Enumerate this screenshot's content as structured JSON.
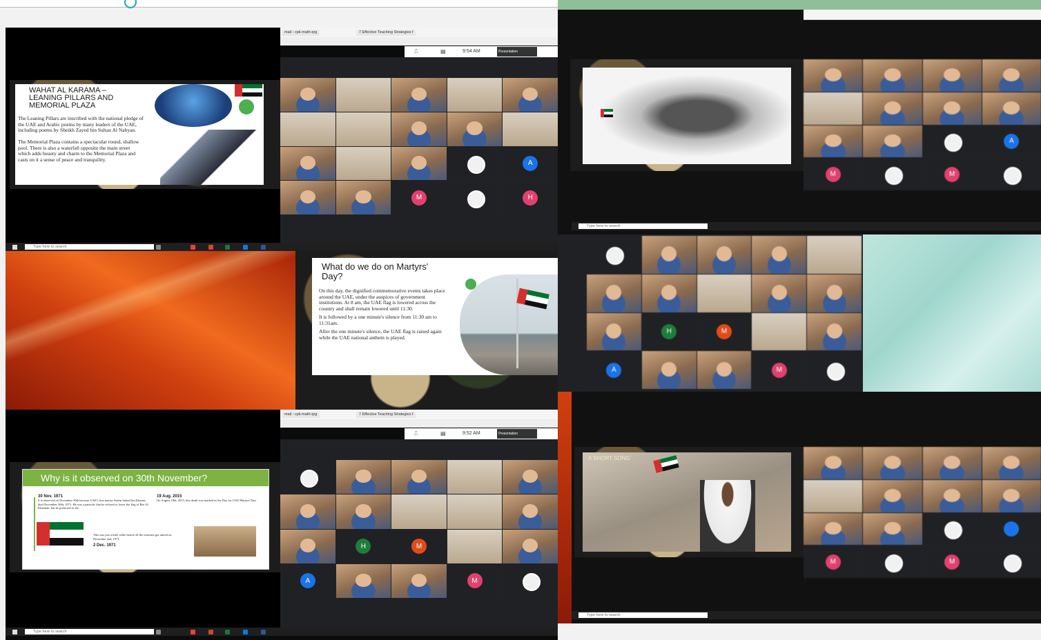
{
  "q1": {
    "browser_tab_1": "mail - cpk-math-qrg",
    "browser_tab_2": "7 Effective Teaching Strategies f",
    "clock": "9:54 AM",
    "presentation_label": "Presentation",
    "slide_title": "WAHAT AL KARAMA – LEANING PILLARS AND MEMORIAL PLAZA",
    "slide_para_1": "The Leaning Pillars are inscribed with the national pledge of the UAE and Arabic poems by many leaders of the UAE, including poems by Sheikh Zayed bin Sultan Al Nahyan.",
    "slide_para_2": "The Memorial Plaza contains a spectacular round, shallow pool. There is also a waterfall opposite the main street which adds beauty and charm to the Memorial Plaza and casts on it a sense of peace and tranquility.",
    "avatars": [
      "A",
      "M",
      "H"
    ],
    "taskbar_search": "Type here to search"
  },
  "q2": {
    "slide_title": "What do we do on Martyrs' Day?",
    "bullets": [
      "On this day, the dignified commemorative events takes place around the UAE, under the auspices of government institutions. At 8 am, the UAE flag is lowered across the country and shall remain lowered until 11:30.",
      "It is followed by a one minute's silence from 11:30 am to 11:31am.",
      "After the one minute's silence, the UAE flag is raised again while the UAE national anthem is played."
    ]
  },
  "q3": {
    "browser_tab_1": "mail - cpk-math-qrg",
    "browser_tab_2": "7 Effective Teaching Strategies f",
    "clock": "9:52 AM",
    "presentation_label": "Presentation",
    "slide_title": "Why is it observed on 30th November?",
    "timeline": [
      {
        "date": "30 Nov. 1971",
        "text": "It is observed on November 30th because UAE's first martyr Salem Suhail bin Khamis died November 30th, 1971. He was a patriotic that he refused to lower the flag of Ras Al Khaimah, but he preferred to die."
      },
      {
        "date": "19 Aug. 2015",
        "text": "On August 19th, 2015, this death was marked as the Day for UAE Martyrs' Day."
      },
      {
        "date": "2 Dec. 1971",
        "text": "This was just a little while before all the emirates got united on December 2nd, 1971."
      }
    ],
    "avatars": [
      "H",
      "M",
      "A",
      "M"
    ],
    "taskbar_search": "Type here to search"
  },
  "q4": {
    "taskbar_search": "Type here to search",
    "avatars_top": [
      "A",
      "M",
      "M"
    ],
    "avatars_mid": [
      "H",
      "M",
      "A",
      "M"
    ],
    "avatars_bot": [
      "M",
      "M"
    ],
    "video_label": "A SHORT SONG"
  },
  "colors": {
    "meet_bg": "#202124",
    "avatar_pink": "#e0416f",
    "avatar_blue": "#1a73e8",
    "avatar_green": "#1e7d3a",
    "avatar_orange": "#e04b1a",
    "slide_green": "#4caf50"
  }
}
